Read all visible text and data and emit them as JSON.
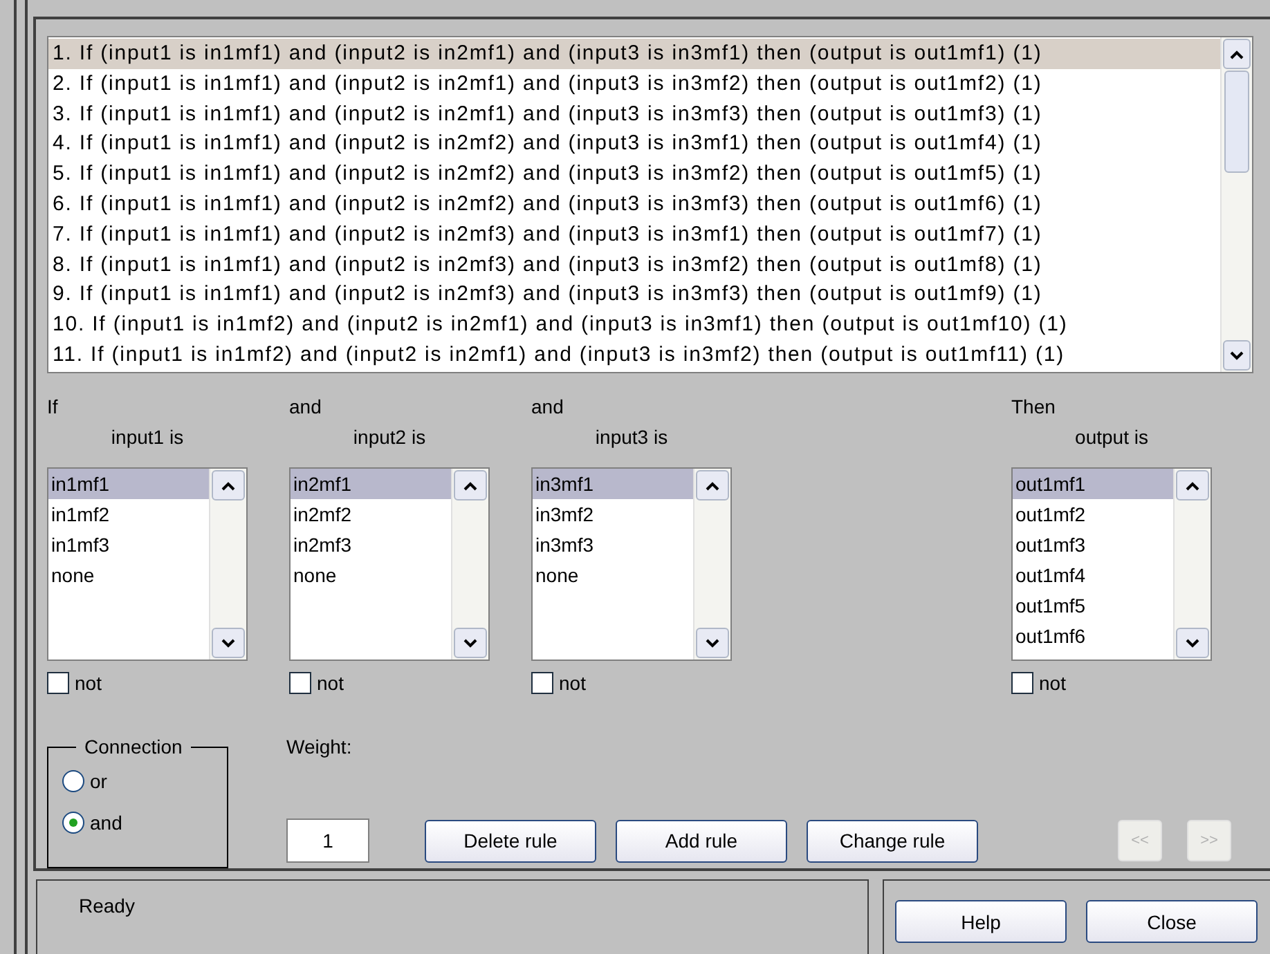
{
  "rules": [
    {
      "text": "1. If (input1 is in1mf1) and (input2 is in2mf1) and (input3 is in3mf1) then (output is out1mf1) (1)",
      "selected": true
    },
    {
      "text": "2. If (input1 is in1mf1) and (input2 is in2mf1) and (input3 is in3mf2) then (output is out1mf2) (1)",
      "selected": false
    },
    {
      "text": "3. If (input1 is in1mf1) and (input2 is in2mf1) and (input3 is in3mf3) then (output is out1mf3) (1)",
      "selected": false
    },
    {
      "text": "4. If (input1 is in1mf1) and (input2 is in2mf2) and (input3 is in3mf1) then (output is out1mf4) (1)",
      "selected": false
    },
    {
      "text": "5. If (input1 is in1mf1) and (input2 is in2mf2) and (input3 is in3mf2) then (output is out1mf5) (1)",
      "selected": false
    },
    {
      "text": "6. If (input1 is in1mf1) and (input2 is in2mf2) and (input3 is in3mf3) then (output is out1mf6) (1)",
      "selected": false
    },
    {
      "text": "7. If (input1 is in1mf1) and (input2 is in2mf3) and (input3 is in3mf1) then (output is out1mf7) (1)",
      "selected": false
    },
    {
      "text": "8. If (input1 is in1mf1) and (input2 is in2mf3) and (input3 is in3mf2) then (output is out1mf8) (1)",
      "selected": false
    },
    {
      "text": "9. If (input1 is in1mf1) and (input2 is in2mf3) and (input3 is in3mf3) then (output is out1mf9) (1)",
      "selected": false
    },
    {
      "text": "10. If (input1 is in1mf2) and (input2 is in2mf1) and (input3 is in3mf1) then (output is out1mf10) (1)",
      "selected": false
    },
    {
      "text": "11. If (input1 is in1mf2) and (input2 is in2mf1) and (input3 is in3mf2) then (output is out1mf11) (1)",
      "selected": false
    }
  ],
  "columns": [
    {
      "connector": "If",
      "label": "input1 is",
      "items": [
        {
          "text": "in1mf1",
          "selected": true
        },
        {
          "text": "in1mf2",
          "selected": false
        },
        {
          "text": "in1mf3",
          "selected": false
        },
        {
          "text": "none",
          "selected": false
        }
      ],
      "not_label": "not",
      "not_checked": false
    },
    {
      "connector": "and",
      "label": "input2 is",
      "items": [
        {
          "text": "in2mf1",
          "selected": true
        },
        {
          "text": "in2mf2",
          "selected": false
        },
        {
          "text": "in2mf3",
          "selected": false
        },
        {
          "text": "none",
          "selected": false
        }
      ],
      "not_label": "not",
      "not_checked": false
    },
    {
      "connector": "and",
      "label": "input3 is",
      "items": [
        {
          "text": "in3mf1",
          "selected": true
        },
        {
          "text": "in3mf2",
          "selected": false
        },
        {
          "text": "in3mf3",
          "selected": false
        },
        {
          "text": "none",
          "selected": false
        }
      ],
      "not_label": "not",
      "not_checked": false
    },
    {
      "connector": "Then",
      "label": "output is",
      "items": [
        {
          "text": "out1mf1",
          "selected": true
        },
        {
          "text": "out1mf2",
          "selected": false
        },
        {
          "text": "out1mf3",
          "selected": false
        },
        {
          "text": "out1mf4",
          "selected": false
        },
        {
          "text": "out1mf5",
          "selected": false
        },
        {
          "text": "out1mf6",
          "selected": false
        }
      ],
      "not_label": "not",
      "not_checked": false
    }
  ],
  "connection": {
    "title": "Connection",
    "options": [
      {
        "label": "or",
        "selected": false
      },
      {
        "label": "and",
        "selected": true
      }
    ]
  },
  "weight": {
    "label": "Weight:",
    "value": "1"
  },
  "buttons": [
    "Delete rule",
    "Add rule",
    "Change rule"
  ],
  "nav_buttons": [
    {
      "label": "<<",
      "disabled": true
    },
    {
      "label": ">>",
      "disabled": true
    }
  ],
  "status_bar": "Ready",
  "footer_buttons": [
    "Help",
    "Close"
  ]
}
